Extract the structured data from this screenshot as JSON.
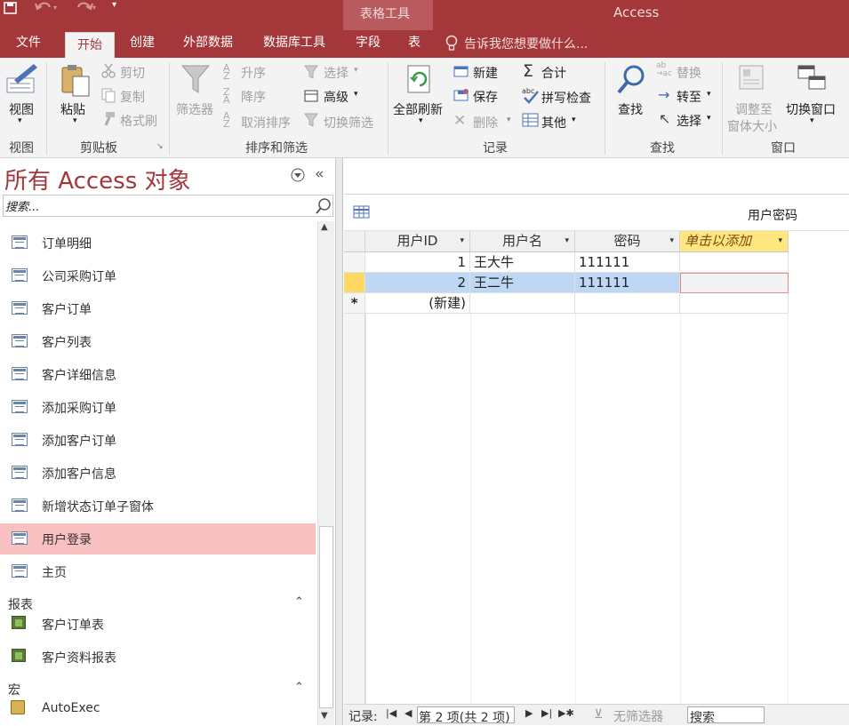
{
  "title_bar": {
    "app_name": "Access",
    "context_group": "表格工具"
  },
  "tabs": [
    "文件",
    "开始",
    "创建",
    "外部数据",
    "数据库工具",
    "字段",
    "表"
  ],
  "tell_me": "告诉我您想要做什么...",
  "ribbon": {
    "view": {
      "label": "视图",
      "group": "视图"
    },
    "clipboard": {
      "paste": "粘贴",
      "cut": "剪切",
      "copy": "复制",
      "format_painter": "格式刷",
      "group": "剪贴板"
    },
    "sort_filter": {
      "filter": "筛选器",
      "ascending": "升序",
      "descending": "降序",
      "remove_sort": "取消排序",
      "selection": "选择",
      "advanced": "高级",
      "toggle_filter": "切换筛选",
      "group": "排序和筛选"
    },
    "records": {
      "refresh_all": "全部刷新",
      "new": "新建",
      "save": "保存",
      "delete": "删除",
      "totals": "合计",
      "spelling": "拼写检查",
      "more": "其他",
      "group": "记录"
    },
    "find": {
      "find": "查找",
      "replace": "替换",
      "goto": "转至",
      "select": "选择",
      "group": "查找"
    },
    "window": {
      "resize1": "调整至",
      "resize2": "窗体大小",
      "switch": "切换窗口",
      "group": "窗口"
    }
  },
  "nav": {
    "title": "所有 Access 对象",
    "search_placeholder": "搜索...",
    "items": [
      "订单明细",
      "公司采购订单",
      "客户订单",
      "客户列表",
      "客户详细信息",
      "添加采购订单",
      "添加客户订单",
      "添加客户信息",
      "新增状态订单子窗体",
      "用户登录",
      "主页"
    ],
    "selected_index": 9,
    "sections": [
      {
        "name": "报表",
        "items": [
          "客户订单表",
          "客户资料报表"
        ]
      },
      {
        "name": "宏",
        "items": [
          "AutoExec"
        ]
      }
    ]
  },
  "table": {
    "tab_title": "用户密码",
    "columns": [
      "用户ID",
      "用户名",
      "密码",
      "单击以添加"
    ],
    "rows": [
      {
        "id": "1",
        "name": "王大牛",
        "password": "111111"
      },
      {
        "id": "2",
        "name": "王二牛",
        "password": "111111"
      }
    ],
    "new_row": "(新建)"
  },
  "status": {
    "record_label": "记录:",
    "position": "第 2 项(共 2 项)",
    "filter": "无筛选器",
    "search": "搜索"
  },
  "colors": {
    "accent": "#a4373a",
    "selected_nav": "#f8c0c0",
    "selected_row": "#bdd7f5",
    "add_column": "#ffe680"
  }
}
